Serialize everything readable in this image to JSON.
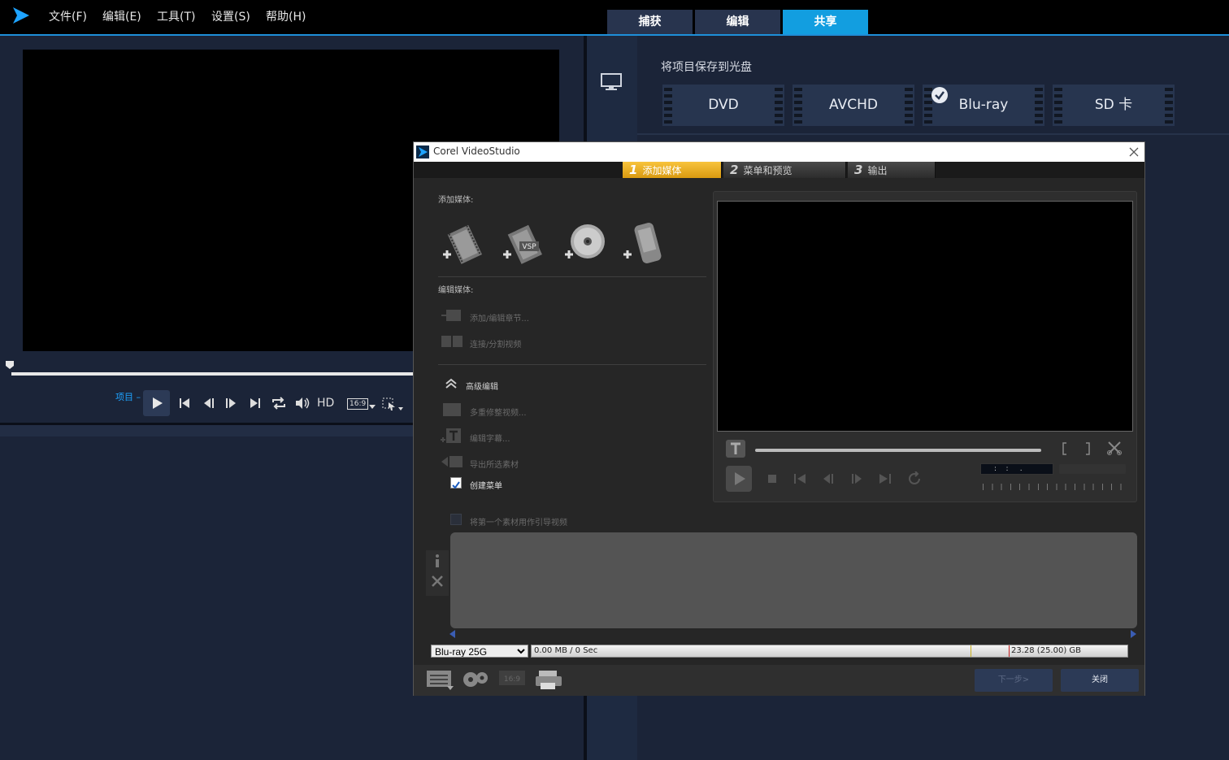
{
  "menubar": {
    "items": [
      "文件(F)",
      "编辑(E)",
      "工具(T)",
      "设置(S)",
      "帮助(H)"
    ]
  },
  "tabs": [
    {
      "label": "捕获",
      "active": false
    },
    {
      "label": "编辑",
      "active": false
    },
    {
      "label": "共享",
      "active": true
    }
  ],
  "player": {
    "project_label": "项目 –",
    "hd_label": "HD",
    "aspect_label": "16:9"
  },
  "share": {
    "title": "将项目保存到光盘",
    "discs": [
      {
        "label": "DVD",
        "selected": false
      },
      {
        "label": "AVCHD",
        "selected": false
      },
      {
        "label": "Blu-ray",
        "selected": true
      },
      {
        "label": "SD 卡",
        "selected": false
      }
    ]
  },
  "dialog": {
    "title": "Corel VideoStudio",
    "steps": [
      {
        "num": "1",
        "label": "添加媒体",
        "active": true
      },
      {
        "num": "2",
        "label": "菜单和预览",
        "active": false
      },
      {
        "num": "3",
        "label": "输出",
        "active": false
      }
    ],
    "add_media_label": "添加媒体:",
    "add_media_icons": [
      "add-video-icon",
      "add-vsp-project-icon",
      "add-disc-icon",
      "add-mobile-device-icon"
    ],
    "vsp_badge": "VSP",
    "edit_media_label": "编辑媒体:",
    "edit_items": [
      {
        "label": "添加/编辑章节...",
        "icon": "chapter-icon"
      },
      {
        "label": "连接/分割视频",
        "icon": "split-video-icon"
      }
    ],
    "advanced_label": "高级编辑",
    "advanced_items": [
      {
        "label": "多重修整视频...",
        "icon": "multi-trim-icon"
      },
      {
        "label": "编辑字幕...",
        "icon": "subtitle-icon"
      },
      {
        "label": "导出所选素材",
        "icon": "export-clip-icon"
      }
    ],
    "create_menu": {
      "label": "创建菜单",
      "checked": true
    },
    "intro_video": {
      "label": "将第一个素材用作引导视频",
      "checked": false
    },
    "disc_type": "Blu-ray 25G",
    "capacity": {
      "used": "0.00 MB / 0 Sec",
      "total": "23.28 (25.00) GB"
    },
    "buttons": {
      "next": "下一步>",
      "close": "关闭"
    }
  },
  "colors": {
    "accent": "#129ee0",
    "step_active": "#f0b428",
    "background": "#1b2438"
  }
}
